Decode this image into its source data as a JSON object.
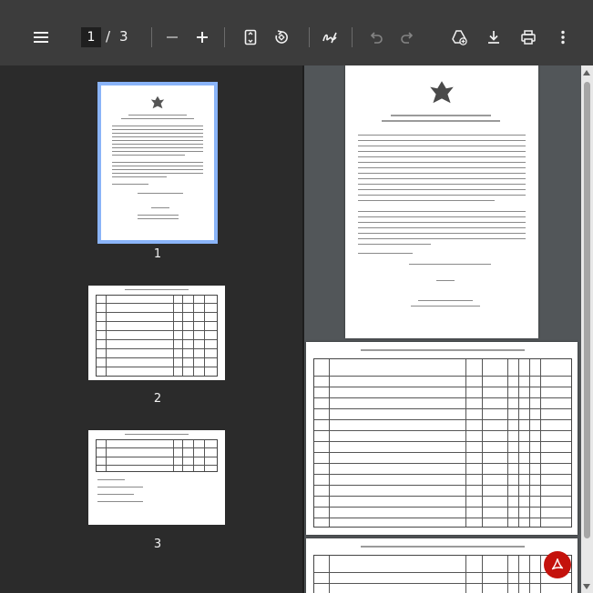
{
  "toolbar": {
    "current_page": "1",
    "separator": "/",
    "total_pages": "3"
  },
  "thumbnails": [
    {
      "label": "1"
    },
    {
      "label": "2"
    },
    {
      "label": "3"
    }
  ],
  "colors": {
    "toolbar_bg": "#3c3c3c",
    "sidebar_bg": "#2b2b2b",
    "viewer_bg": "#525659",
    "active_outline": "#8ab4f8",
    "fab_bg": "#c4120c"
  },
  "icons": [
    "menu-icon",
    "zoom-out-icon",
    "zoom-in-icon",
    "fit-page-icon",
    "rotate-icon",
    "annotate-icon",
    "undo-icon",
    "redo-icon",
    "add-drive-icon",
    "download-icon",
    "print-icon",
    "more-icon",
    "acrobat-icon"
  ]
}
